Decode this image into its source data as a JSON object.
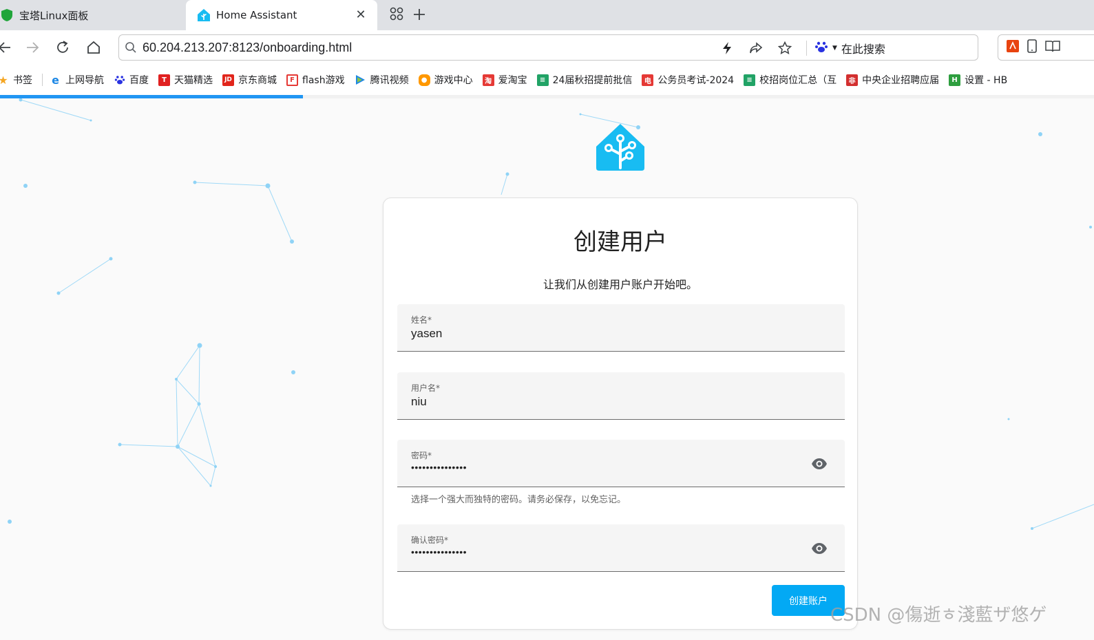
{
  "tabs": [
    {
      "title": "宝塔Linux面板",
      "active": false
    },
    {
      "title": "Home Assistant",
      "active": true
    }
  ],
  "address_bar": {
    "url": "60.204.213.207:8123/onboarding.html"
  },
  "search_engine": {
    "label": "在此搜索"
  },
  "bookmarks": [
    {
      "label": "书签",
      "icon": "star-icon",
      "color": "#f5a623"
    },
    {
      "label": "上网导航",
      "icon": "ie-icon",
      "color": "#1e88e5"
    },
    {
      "label": "百度",
      "icon": "baidu-paw-icon",
      "color": "#2932e1"
    },
    {
      "label": "天猫精选",
      "icon": "tmall-icon",
      "color": "#e02020"
    },
    {
      "label": "京东商城",
      "icon": "jd-icon",
      "color": "#e1251b"
    },
    {
      "label": "flash游戏",
      "icon": "flash-game-icon",
      "color": "#e53935"
    },
    {
      "label": "腾讯视频",
      "icon": "tencent-video-icon",
      "color": "#1e88e5"
    },
    {
      "label": "游戏中心",
      "icon": "gamepad-icon",
      "color": "#ff9800"
    },
    {
      "label": "爱淘宝",
      "icon": "taobao-icon",
      "color": "#e53935"
    },
    {
      "label": "24届秋招提前批信",
      "icon": "sheet-icon",
      "color": "#21a366"
    },
    {
      "label": "公务员考试-2024",
      "icon": "exam-icon",
      "color": "#e53935"
    },
    {
      "label": "校招岗位汇总（互",
      "icon": "sheet-icon",
      "color": "#21a366"
    },
    {
      "label": "中央企业招聘应届",
      "icon": "soe-icon",
      "color": "#d32f2f"
    },
    {
      "label": "设置 - HB",
      "icon": "hb-icon",
      "color": "#2e9e3f"
    }
  ],
  "progress": {
    "fraction": 0.277
  },
  "onboarding": {
    "title": "创建用户",
    "subtitle": "让我们从创建用户账户开始吧。",
    "fields": {
      "name": {
        "label": "姓名*",
        "value": "yasen"
      },
      "username": {
        "label": "用户名*",
        "value": "niu"
      },
      "password": {
        "label": "密码*",
        "value": "•••••••••••••••",
        "helper": "选择一个强大而独特的密码。请务必保存，以免忘记。"
      },
      "password_confirm": {
        "label": "确认密码*",
        "value": "•••••••••••••••"
      }
    },
    "submit_label": "创建账户"
  },
  "watermark": "CSDN @傷逝ㅎ淺藍ザ悠ゲ",
  "colors": {
    "accent": "#03a9f4",
    "ha_brand": "#18bcf2",
    "progress": "#2196f3"
  }
}
